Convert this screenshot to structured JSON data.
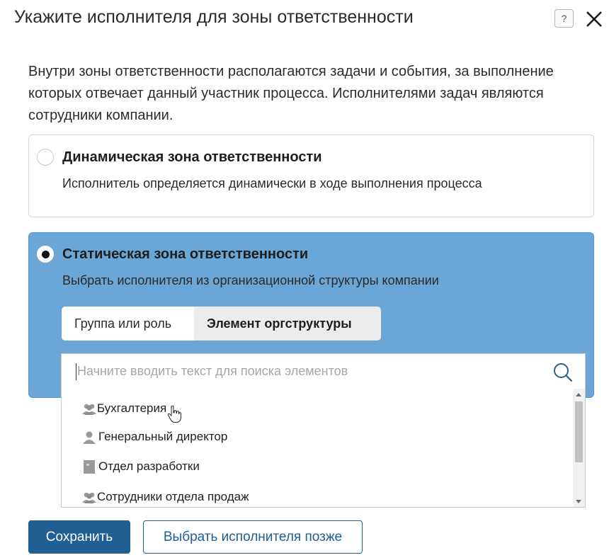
{
  "dialog": {
    "title": "Укажите исполнителя для зоны ответственности",
    "help_label": "?",
    "description": "Внутри зоны ответственности располагаются задачи и события, за выполнение которых отвечает данный участник процесса. Исполнителями задач являются сотрудники компании."
  },
  "options": {
    "dynamic": {
      "title": "Динамическая зона ответственности",
      "subtitle": "Исполнитель определяется динамически в ходе выполнения процесса",
      "selected": false
    },
    "static": {
      "title": "Статическая зона ответственности",
      "subtitle": "Выбрать исполнителя из организационной структуры компании",
      "selected": true
    }
  },
  "tabs": [
    {
      "label": "Группа или роль",
      "active": false
    },
    {
      "label": "Элемент оргструктуры",
      "active": true
    }
  ],
  "search": {
    "value": "",
    "placeholder": "Начните вводить текст для поиска элементов"
  },
  "dropdown": {
    "items": [
      {
        "label": "Бухгалтерия",
        "icon": "group-icon"
      },
      {
        "label": "Генеральный директор",
        "icon": "user-icon"
      },
      {
        "label": "Отдел разработки",
        "icon": "department-icon"
      },
      {
        "label": "Сотрудники отдела продаж",
        "icon": "group-icon"
      }
    ]
  },
  "buttons": {
    "save": "Сохранить",
    "choose_later": "Выбрать исполнителя позже"
  },
  "colors": {
    "selected_card_bg": "#6aa6d6",
    "primary": "#1f5f93",
    "icon_gray": "#9a9a9a"
  }
}
